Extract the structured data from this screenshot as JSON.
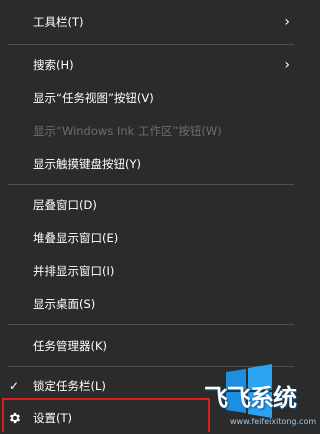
{
  "menu": {
    "items": [
      {
        "label": "工具栏(T)",
        "has_submenu": true
      },
      {
        "label": "搜索(H)",
        "has_submenu": true
      },
      {
        "label": "显示“任务视图”按钮(V)"
      },
      {
        "label": "显示“Windows Ink 工作区”按钮(W)",
        "disabled": true
      },
      {
        "label": "显示触摸键盘按钮(Y)"
      },
      {
        "label": "层叠窗口(D)"
      },
      {
        "label": "堆叠显示窗口(E)"
      },
      {
        "label": "并排显示窗口(I)"
      },
      {
        "label": "显示桌面(S)"
      },
      {
        "label": "任务管理器(K)"
      },
      {
        "label": "锁定任务栏(L)",
        "checked": true
      },
      {
        "label": "设置(T)",
        "icon": "gear-icon",
        "highlighted": true
      }
    ]
  },
  "watermark": {
    "logo_text": "飞飞系统",
    "url": "www.feifeixitong.com"
  },
  "colors": {
    "menu_bg": "#2b2b2b",
    "text": "#ffffff",
    "disabled_text": "#6d6d6d",
    "separator": "#4e4e4e",
    "highlight_border": "#d81e1e"
  }
}
